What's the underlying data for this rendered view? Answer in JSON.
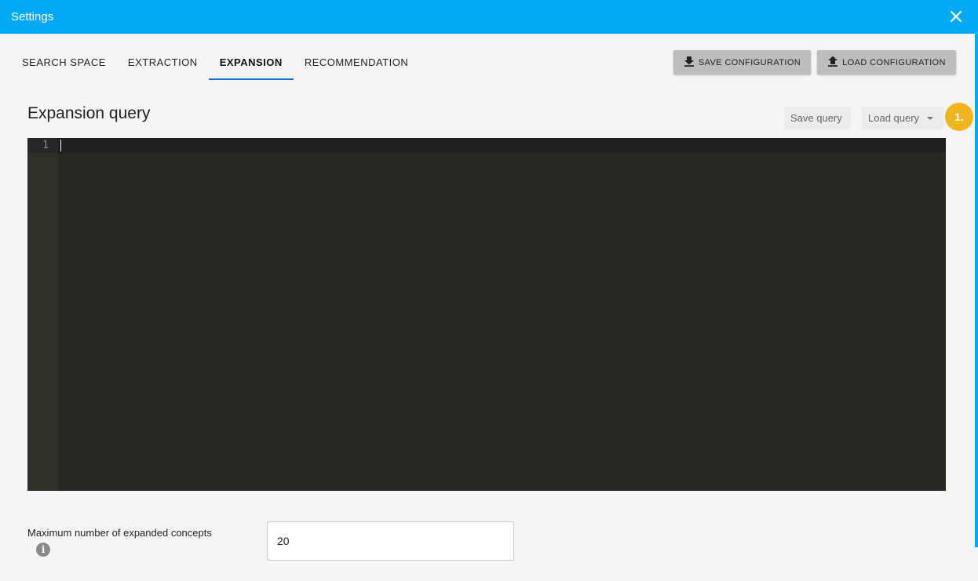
{
  "window": {
    "title": "Settings"
  },
  "tabs": [
    {
      "label": "SEARCH SPACE"
    },
    {
      "label": "EXTRACTION"
    },
    {
      "label": "EXPANSION"
    },
    {
      "label": "RECOMMENDATION"
    }
  ],
  "toolbar": {
    "save_config_label": "SAVE CONFIGURATION",
    "load_config_label": "LOAD CONFIGURATION"
  },
  "query": {
    "heading": "Expansion query",
    "save_label": "Save query",
    "load_label": "Load query",
    "badge": "1."
  },
  "editor": {
    "line_number": "1"
  },
  "max_concepts": {
    "label": "Maximum number of expanded concepts",
    "value": "20"
  },
  "colors": {
    "accent": "#03a9f4",
    "active_tab_indicator": "#1976d2",
    "badge": "#f0b41c",
    "editor_bg": "#272822"
  }
}
